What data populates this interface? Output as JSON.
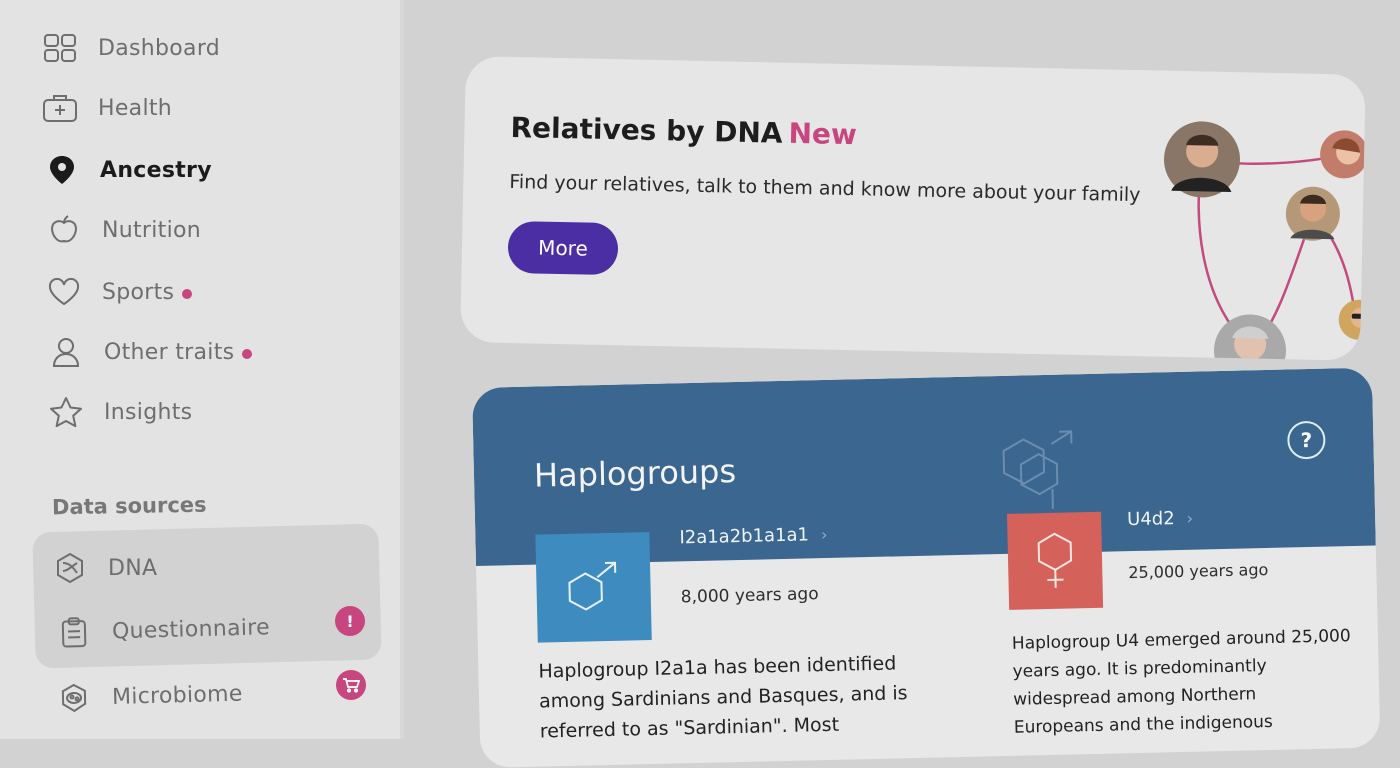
{
  "nav": {
    "items": [
      {
        "label": "Dashboard",
        "icon": "dashboard-icon"
      },
      {
        "label": "Health",
        "icon": "first-aid-kit-icon"
      },
      {
        "label": "Ancestry",
        "icon": "map-pin-icon",
        "active": true
      },
      {
        "label": "Nutrition",
        "icon": "apple-icon"
      },
      {
        "label": "Sports",
        "icon": "heart-icon",
        "dot": true
      },
      {
        "label": "Other traits",
        "icon": "person-icon",
        "dot": true
      },
      {
        "label": "Insights",
        "icon": "star-icon"
      }
    ]
  },
  "data_sources": {
    "label": "Data sources",
    "items": [
      {
        "label": "DNA",
        "icon": "dna-icon"
      },
      {
        "label": "Questionnaire",
        "icon": "clipboard-icon",
        "badge": "!"
      },
      {
        "label": "Microbiome",
        "icon": "microbiome-icon",
        "badge": "cart"
      }
    ]
  },
  "relatives": {
    "title": "Relatives by DNA",
    "tag": "New",
    "subtitle": "Find your relatives, talk to them and know more about your family",
    "button": "More"
  },
  "haplogroups": {
    "title": "Haplogroups",
    "help": "?",
    "paternal": {
      "name": "I2a1a2b1a1a1",
      "age": "8,000 years ago",
      "description": [
        "Haplogroup I2a1a has been identified",
        "among Sardinians and Basques, and is",
        "referred to as \"Sardinian\". Most"
      ]
    },
    "maternal": {
      "name": "U4d2",
      "age": "25,000 years ago",
      "description": [
        "Haplogroup U4 emerged around 25,000",
        "years ago. It is predominantly",
        "widespread among Northern",
        "Europeans and the indigenous"
      ]
    }
  },
  "colors": {
    "accent": "#c7467f",
    "button": "#4b2ea3",
    "haplo_header": "#3a6690",
    "paternal": "#3e8bbf",
    "maternal": "#d5625a"
  }
}
